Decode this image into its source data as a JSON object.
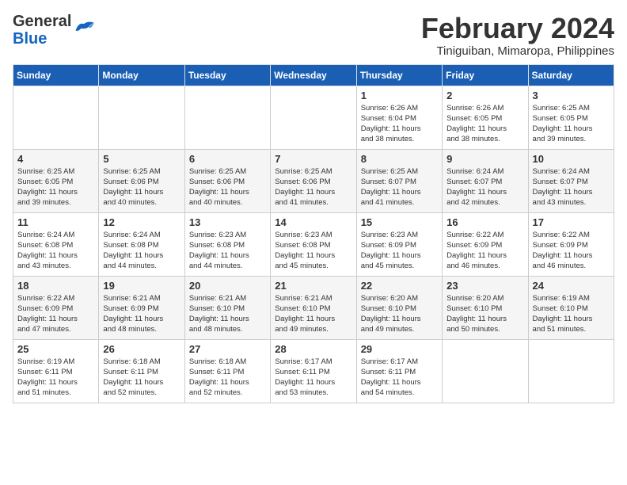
{
  "header": {
    "logo_general": "General",
    "logo_blue": "Blue",
    "month_year": "February 2024",
    "location": "Tiniguiban, Mimaropa, Philippines"
  },
  "days_of_week": [
    "Sunday",
    "Monday",
    "Tuesday",
    "Wednesday",
    "Thursday",
    "Friday",
    "Saturday"
  ],
  "weeks": [
    [
      {
        "day": "",
        "info": ""
      },
      {
        "day": "",
        "info": ""
      },
      {
        "day": "",
        "info": ""
      },
      {
        "day": "",
        "info": ""
      },
      {
        "day": "1",
        "info": "Sunrise: 6:26 AM\nSunset: 6:04 PM\nDaylight: 11 hours\nand 38 minutes."
      },
      {
        "day": "2",
        "info": "Sunrise: 6:26 AM\nSunset: 6:05 PM\nDaylight: 11 hours\nand 38 minutes."
      },
      {
        "day": "3",
        "info": "Sunrise: 6:25 AM\nSunset: 6:05 PM\nDaylight: 11 hours\nand 39 minutes."
      }
    ],
    [
      {
        "day": "4",
        "info": "Sunrise: 6:25 AM\nSunset: 6:05 PM\nDaylight: 11 hours\nand 39 minutes."
      },
      {
        "day": "5",
        "info": "Sunrise: 6:25 AM\nSunset: 6:06 PM\nDaylight: 11 hours\nand 40 minutes."
      },
      {
        "day": "6",
        "info": "Sunrise: 6:25 AM\nSunset: 6:06 PM\nDaylight: 11 hours\nand 40 minutes."
      },
      {
        "day": "7",
        "info": "Sunrise: 6:25 AM\nSunset: 6:06 PM\nDaylight: 11 hours\nand 41 minutes."
      },
      {
        "day": "8",
        "info": "Sunrise: 6:25 AM\nSunset: 6:07 PM\nDaylight: 11 hours\nand 41 minutes."
      },
      {
        "day": "9",
        "info": "Sunrise: 6:24 AM\nSunset: 6:07 PM\nDaylight: 11 hours\nand 42 minutes."
      },
      {
        "day": "10",
        "info": "Sunrise: 6:24 AM\nSunset: 6:07 PM\nDaylight: 11 hours\nand 43 minutes."
      }
    ],
    [
      {
        "day": "11",
        "info": "Sunrise: 6:24 AM\nSunset: 6:08 PM\nDaylight: 11 hours\nand 43 minutes."
      },
      {
        "day": "12",
        "info": "Sunrise: 6:24 AM\nSunset: 6:08 PM\nDaylight: 11 hours\nand 44 minutes."
      },
      {
        "day": "13",
        "info": "Sunrise: 6:23 AM\nSunset: 6:08 PM\nDaylight: 11 hours\nand 44 minutes."
      },
      {
        "day": "14",
        "info": "Sunrise: 6:23 AM\nSunset: 6:08 PM\nDaylight: 11 hours\nand 45 minutes."
      },
      {
        "day": "15",
        "info": "Sunrise: 6:23 AM\nSunset: 6:09 PM\nDaylight: 11 hours\nand 45 minutes."
      },
      {
        "day": "16",
        "info": "Sunrise: 6:22 AM\nSunset: 6:09 PM\nDaylight: 11 hours\nand 46 minutes."
      },
      {
        "day": "17",
        "info": "Sunrise: 6:22 AM\nSunset: 6:09 PM\nDaylight: 11 hours\nand 46 minutes."
      }
    ],
    [
      {
        "day": "18",
        "info": "Sunrise: 6:22 AM\nSunset: 6:09 PM\nDaylight: 11 hours\nand 47 minutes."
      },
      {
        "day": "19",
        "info": "Sunrise: 6:21 AM\nSunset: 6:09 PM\nDaylight: 11 hours\nand 48 minutes."
      },
      {
        "day": "20",
        "info": "Sunrise: 6:21 AM\nSunset: 6:10 PM\nDaylight: 11 hours\nand 48 minutes."
      },
      {
        "day": "21",
        "info": "Sunrise: 6:21 AM\nSunset: 6:10 PM\nDaylight: 11 hours\nand 49 minutes."
      },
      {
        "day": "22",
        "info": "Sunrise: 6:20 AM\nSunset: 6:10 PM\nDaylight: 11 hours\nand 49 minutes."
      },
      {
        "day": "23",
        "info": "Sunrise: 6:20 AM\nSunset: 6:10 PM\nDaylight: 11 hours\nand 50 minutes."
      },
      {
        "day": "24",
        "info": "Sunrise: 6:19 AM\nSunset: 6:10 PM\nDaylight: 11 hours\nand 51 minutes."
      }
    ],
    [
      {
        "day": "25",
        "info": "Sunrise: 6:19 AM\nSunset: 6:11 PM\nDaylight: 11 hours\nand 51 minutes."
      },
      {
        "day": "26",
        "info": "Sunrise: 6:18 AM\nSunset: 6:11 PM\nDaylight: 11 hours\nand 52 minutes."
      },
      {
        "day": "27",
        "info": "Sunrise: 6:18 AM\nSunset: 6:11 PM\nDaylight: 11 hours\nand 52 minutes."
      },
      {
        "day": "28",
        "info": "Sunrise: 6:17 AM\nSunset: 6:11 PM\nDaylight: 11 hours\nand 53 minutes."
      },
      {
        "day": "29",
        "info": "Sunrise: 6:17 AM\nSunset: 6:11 PM\nDaylight: 11 hours\nand 54 minutes."
      },
      {
        "day": "",
        "info": ""
      },
      {
        "day": "",
        "info": ""
      }
    ]
  ]
}
